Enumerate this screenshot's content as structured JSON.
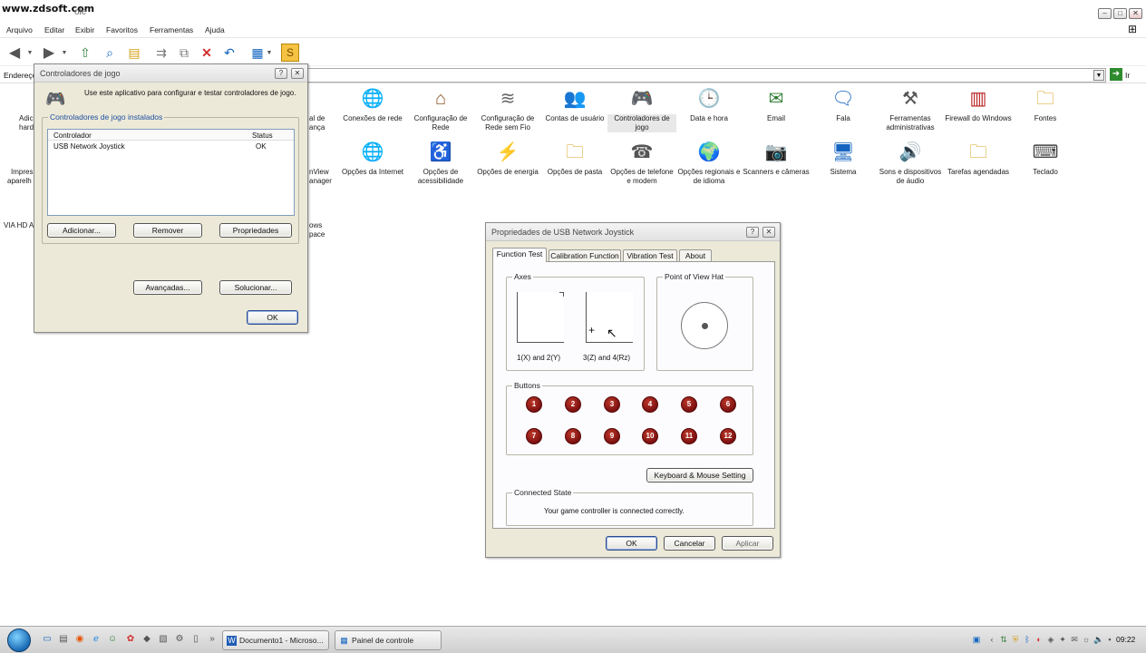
{
  "window": {
    "watermark": "www.zdsoft.com",
    "title_fragment": "ole"
  },
  "menu": [
    "Arquivo",
    "Editar",
    "Exibir",
    "Favoritos",
    "Ferramentas",
    "Ajuda"
  ],
  "address": {
    "label": "Endereço",
    "go_label": "Ir"
  },
  "control_panel": {
    "row1": [
      {
        "label": "Conexões de rede",
        "icon": "globe-network-icon"
      },
      {
        "label": "Configuração de Rede",
        "icon": "house-network-icon"
      },
      {
        "label": "Configuração de Rede sem Fio",
        "icon": "wireless-icon"
      },
      {
        "label": "Contas de usuário",
        "icon": "users-icon"
      },
      {
        "label": "Controladores de jogo",
        "icon": "gamepad-icon"
      },
      {
        "label": "Data e hora",
        "icon": "clock-icon"
      },
      {
        "label": "Email",
        "icon": "mail-icon"
      },
      {
        "label": "Fala",
        "icon": "speech-icon"
      },
      {
        "label": "Ferramentas administrativas",
        "icon": "tools-icon"
      },
      {
        "label": "Firewall do Windows",
        "icon": "firewall-icon"
      },
      {
        "label": "Fontes",
        "icon": "fonts-folder-icon"
      }
    ],
    "row2": [
      {
        "label": "Opções da Internet",
        "icon": "internet-options-icon"
      },
      {
        "label": "Opções de acessibilidade",
        "icon": "accessibility-icon"
      },
      {
        "label": "Opções de energia",
        "icon": "power-icon"
      },
      {
        "label": "Opções de pasta",
        "icon": "folder-options-icon"
      },
      {
        "label": "Opções de telefone e modem",
        "icon": "phone-icon"
      },
      {
        "label": "Opções regionais e de idioma",
        "icon": "globe-icon"
      },
      {
        "label": "Scanners e câmeras",
        "icon": "scanner-icon"
      },
      {
        "label": "Sistema",
        "icon": "system-icon"
      },
      {
        "label": "Sons e dispositivos de áudio",
        "icon": "speaker-icon"
      },
      {
        "label": "Tarefas agendadas",
        "icon": "scheduled-tasks-icon"
      },
      {
        "label": "Teclado",
        "icon": "keyboard-icon"
      }
    ],
    "fragments": {
      "left1": "Adic",
      "left2": "hard",
      "left3": "Impres",
      "left4": "aparelh",
      "left5": "VIA HD A",
      "mid1": "al de",
      "mid2": "ança",
      "mid3": "nView",
      "mid4": "anager",
      "mid5": "ows",
      "mid6": "pace"
    }
  },
  "game_dialog": {
    "title": "Controladores de jogo",
    "description": "Use este aplicativo para configurar e testar controladores de jogo.",
    "group_label": "Controladores de jogo instalados",
    "col_controller": "Controlador",
    "col_status": "Status",
    "row_name": "USB Network Joystick",
    "row_status": "OK",
    "btn_add": "Adicionar...",
    "btn_remove": "Remover",
    "btn_props": "Propriedades",
    "btn_advanced": "Avançadas...",
    "btn_troubleshoot": "Solucionar...",
    "btn_ok": "OK"
  },
  "props_dialog": {
    "title": "Propriedades de USB Network Joystick",
    "tabs": [
      "Function Test",
      "Calibration Function",
      "Vibration Test",
      "About"
    ],
    "axes_label": "Axes",
    "axis1_label": "1(X) and 2(Y)",
    "axis2_label": "3(Z) and 4(Rz)",
    "pov_label": "Point of View Hat",
    "buttons_label": "Buttons",
    "buttons": [
      "1",
      "2",
      "3",
      "4",
      "5",
      "6",
      "7",
      "8",
      "9",
      "10",
      "11",
      "12"
    ],
    "keyboard_btn": "Keyboard & Mouse Setting",
    "connected_label": "Connected State",
    "connected_text": "Your game controller is connected correctly.",
    "btn_ok": "OK",
    "btn_cancel": "Cancelar",
    "btn_apply": "Aplicar"
  },
  "taskbar": {
    "tasks": [
      "Documento1 - Microso...",
      "Painel de controle"
    ],
    "clock": "09:22"
  }
}
